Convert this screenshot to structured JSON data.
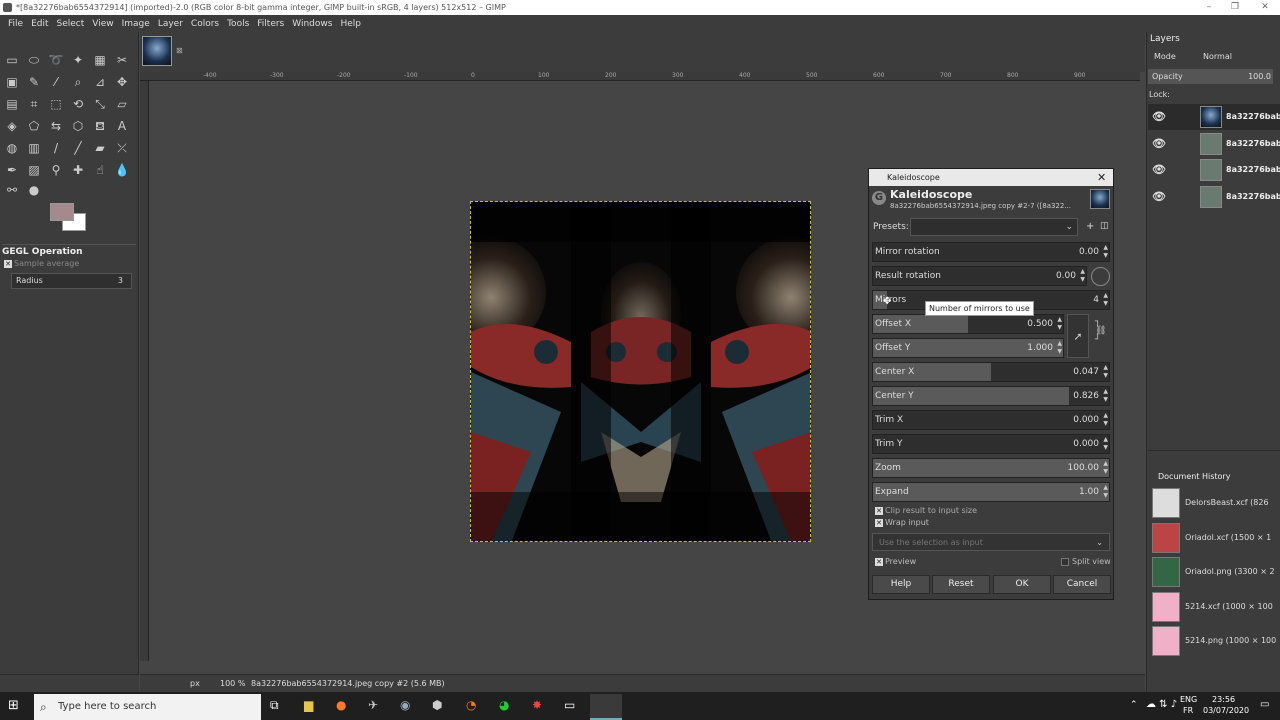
{
  "window": {
    "title": "*[8a32276bab6554372914] (imported)-2.0 (RGB color 8-bit gamma integer, GIMP built-in sRGB, 4 layers) 512x512 – GIMP",
    "controls": [
      "–",
      "❐",
      "✕"
    ]
  },
  "menu": [
    "File",
    "Edit",
    "Select",
    "View",
    "Image",
    "Layer",
    "Colors",
    "Tools",
    "Filters",
    "Windows",
    "Help"
  ],
  "toolbox": {
    "options_title": "GEGL Operation",
    "sample_average": "Sample average",
    "radius_label": "Radius",
    "radius_value": "3"
  },
  "rulers": {
    "top_ticks": [
      "-400",
      "-300",
      "-200",
      "-100",
      "0",
      "100",
      "200",
      "300",
      "400",
      "500",
      "600",
      "700",
      "800",
      "900"
    ]
  },
  "status": {
    "unit": "px",
    "zoom": "100 %",
    "info": "8a32276bab6554372914.jpeg copy #2 (5.6 MB)"
  },
  "layers_panel": {
    "title": "Layers",
    "mode_label": "Mode",
    "mode_value": "Normal",
    "opacity_label": "Opacity",
    "opacity_value": "100.0",
    "lock_label": "Lock:",
    "layers": [
      {
        "name": "8a32276bab"
      },
      {
        "name": "8a32276bab"
      },
      {
        "name": "8a32276bab"
      },
      {
        "name": "8a32276bab"
      }
    ]
  },
  "history_panel": {
    "title": "Document History",
    "items": [
      {
        "label": "DelorsBeast.xcf (826"
      },
      {
        "label": "Oriadol.xcf (1500 × 1"
      },
      {
        "label": "Oriadol.png (3300 × 2"
      },
      {
        "label": "5214.xcf (1000 × 100"
      },
      {
        "label": "5214.png (1000 × 100"
      }
    ]
  },
  "dialog": {
    "window_title": "Kaleidoscope",
    "heading": "Kaleidoscope",
    "subheading": "8a32276bab6554372914.jpeg copy #2-7 ([8a322...",
    "presets_label": "Presets:",
    "sliders": [
      {
        "label": "Mirror rotation",
        "value": "0.00",
        "fill": 0.0
      },
      {
        "label": "Result rotation",
        "value": "0.00",
        "fill": 0.0
      },
      {
        "label": "Mirrors",
        "value": "4",
        "fill": 0.06
      },
      {
        "label": "Offset X",
        "value": "0.500",
        "fill": 0.5
      },
      {
        "label": "Offset Y",
        "value": "1.000",
        "fill": 1.0
      },
      {
        "label": "Center X",
        "value": "0.047",
        "fill": 0.5
      },
      {
        "label": "Center Y",
        "value": "0.826",
        "fill": 0.83
      },
      {
        "label": "Trim X",
        "value": "0.000",
        "fill": 0.0
      },
      {
        "label": "Trim Y",
        "value": "0.000",
        "fill": 0.0
      },
      {
        "label": "Zoom",
        "value": "100.00",
        "fill": 1.0
      },
      {
        "label": "Expand",
        "value": "1.00",
        "fill": 1.0
      }
    ],
    "tooltip": "Number of mirrors to use",
    "clip_label": "Clip result to input size",
    "wrap_label": "Wrap input",
    "selection_placeholder": "Use the selection as input",
    "preview_label": "Preview",
    "split_label": "Split view",
    "buttons": {
      "help": "Help",
      "reset": "Reset",
      "ok": "OK",
      "cancel": "Cancel"
    }
  },
  "taskbar": {
    "search_placeholder": "Type here to search",
    "lang1": "ENG",
    "lang2": "FR",
    "time": "23:56",
    "date": "03/07/2020"
  }
}
